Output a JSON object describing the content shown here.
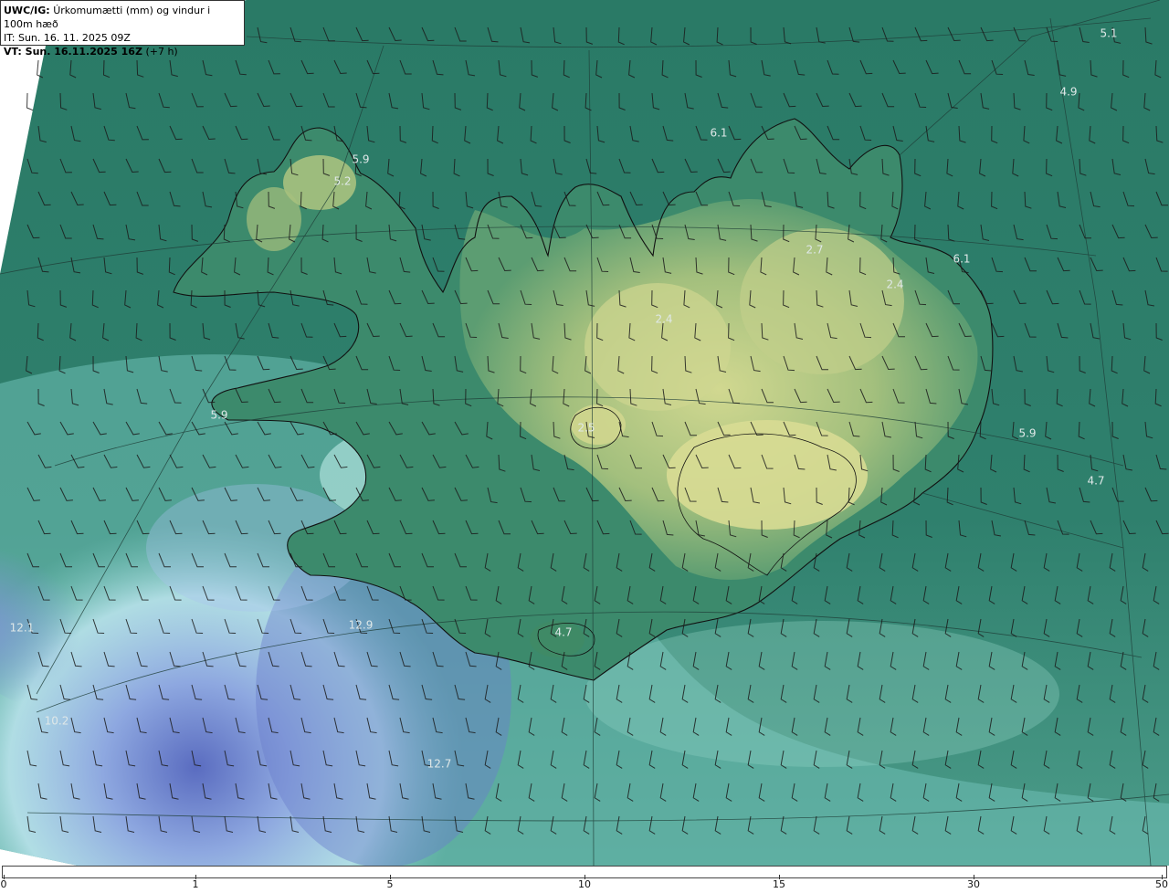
{
  "header": {
    "model": "UWC/IG:",
    "description": "Úrkomumætti (mm) og vindur i 100m hæð",
    "issue_time": "IT: Sun. 16. 11. 2025 09Z",
    "valid_prefix": "VT: Sun. 16.11.2025 16Z",
    "valid_offset": "(+7 h)"
  },
  "map": {
    "region": "Iceland",
    "field": "precipitable water",
    "value_labels": [
      {
        "text": "5.1",
        "name": "value-label-ne-corner"
      },
      {
        "text": "4.9",
        "name": "value-label-ne-sea"
      },
      {
        "text": "6.1",
        "name": "value-label-north-sea"
      },
      {
        "text": "5.9",
        "name": "value-label-westfjords"
      },
      {
        "text": "5.2",
        "name": "value-label-westfjords-inland"
      },
      {
        "text": "2.7",
        "name": "value-label-northeast-highland"
      },
      {
        "text": "6.1",
        "name": "value-label-east-coast"
      },
      {
        "text": "2.4",
        "name": "value-label-east-highland"
      },
      {
        "text": "2.4",
        "name": "value-label-central-north"
      },
      {
        "text": "2.5",
        "name": "value-label-langjokull"
      },
      {
        "text": "5.9",
        "name": "value-label-east-sea"
      },
      {
        "text": "4.7",
        "name": "value-label-southeast-sea"
      },
      {
        "text": "5.9",
        "name": "value-label-snaefellsnes"
      },
      {
        "text": "4.7",
        "name": "value-label-eyjafjallajokull"
      },
      {
        "text": "12.1",
        "name": "value-label-west-sea"
      },
      {
        "text": "12.9",
        "name": "value-label-southwest-sea"
      },
      {
        "text": "10.2",
        "name": "value-label-far-southwest"
      },
      {
        "text": "12.7",
        "name": "value-label-south-sea"
      }
    ]
  },
  "colorbar": {
    "ticks": [
      "0",
      "1",
      "5",
      "10",
      "15",
      "30",
      "50"
    ],
    "colors": [
      "#4a3828",
      "#8a7a50",
      "#d9d989",
      "#e8e4a0",
      "#2e7f6a",
      "#1e6b58",
      "#c8f2ee",
      "#a9c9ee",
      "#5566c0",
      "#1a1d7a",
      "#4a1a90",
      "#a040b0",
      "#e090e0",
      "#f4b0e8"
    ]
  }
}
